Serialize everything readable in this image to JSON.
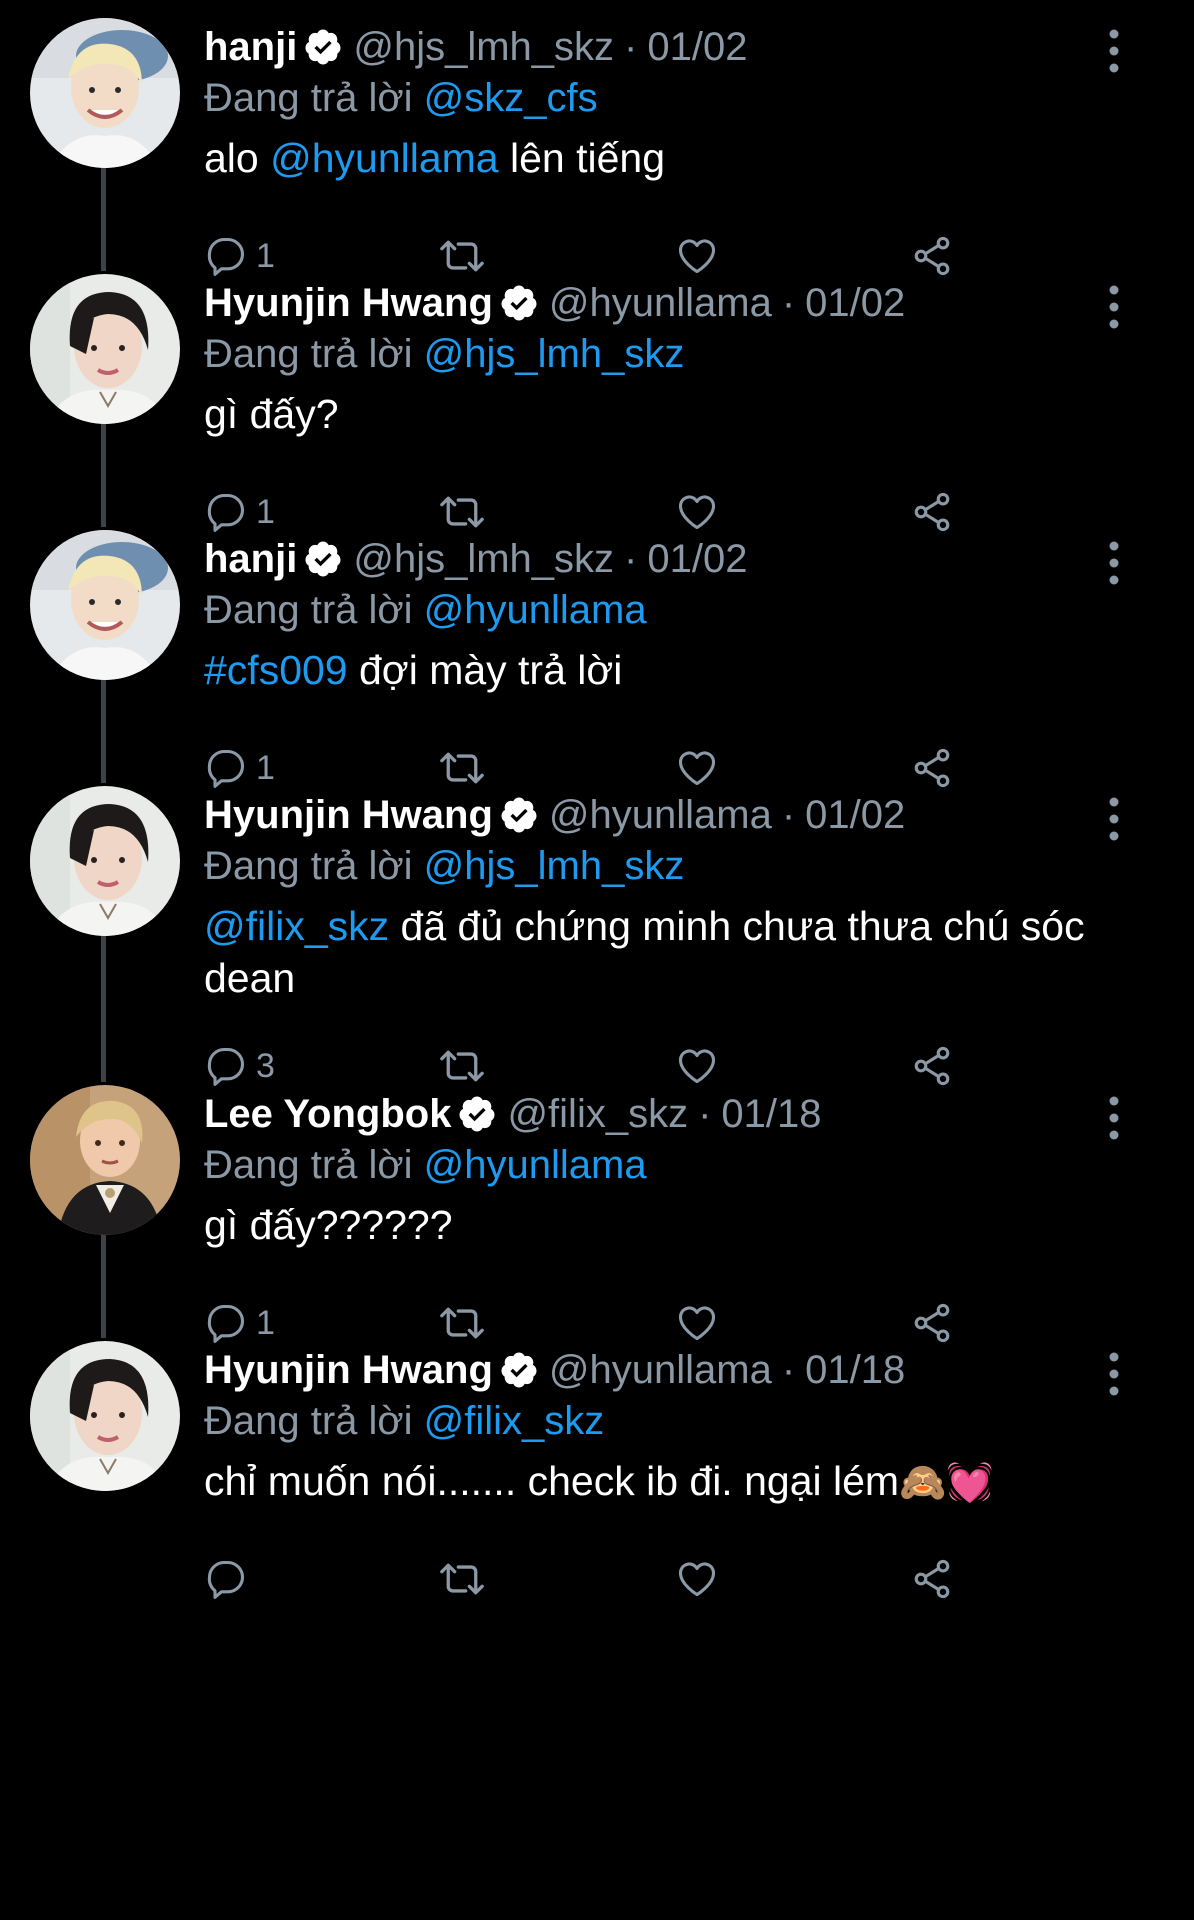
{
  "colors": {
    "background": "#000000",
    "text": "#ffffff",
    "secondary": "#8b98a5",
    "link": "#1d9bf0",
    "thread_line": "#3d4247"
  },
  "icons": {
    "verified": "verified-badge-icon",
    "more": "more-vertical-icon",
    "reply": "reply-bubble-icon",
    "retweet": "retweet-icon",
    "like": "heart-icon",
    "share": "share-icon"
  },
  "tweets": [
    {
      "name": "hanji",
      "handle": "@hjs_lmh_skz",
      "sep": "·",
      "date": "01/02",
      "replying_prefix": "Đang trả lời",
      "replying_to": "@skz_cfs",
      "text_parts": [
        {
          "text": "alo ",
          "link": false
        },
        {
          "text": "@hyunllama",
          "link": true
        },
        {
          "text": " lên tiếng",
          "link": false
        }
      ],
      "reply_count": "1",
      "avatar": "hanji"
    },
    {
      "name": "Hyunjin Hwang",
      "handle": "@hyunllama",
      "sep": "·",
      "date": "01/02",
      "replying_prefix": "Đang trả lời",
      "replying_to": "@hjs_lmh_skz",
      "text_parts": [
        {
          "text": "gì đấy?",
          "link": false
        }
      ],
      "reply_count": "1",
      "avatar": "hyunjin"
    },
    {
      "name": "hanji",
      "handle": "@hjs_lmh_skz",
      "sep": "·",
      "date": "01/02",
      "replying_prefix": "Đang trả lời",
      "replying_to": "@hyunllama",
      "text_parts": [
        {
          "text": "#cfs009",
          "link": true
        },
        {
          "text": " đợi mày trả lời",
          "link": false
        }
      ],
      "reply_count": "1",
      "avatar": "hanji"
    },
    {
      "name": "Hyunjin Hwang",
      "handle": "@hyunllama",
      "sep": "·",
      "date": "01/02",
      "replying_prefix": "Đang trả lời",
      "replying_to": "@hjs_lmh_skz",
      "text_parts": [
        {
          "text": "@filix_skz",
          "link": true
        },
        {
          "text": " đã đủ chứng minh chưa thưa chú sóc dean",
          "link": false
        }
      ],
      "reply_count": "3",
      "avatar": "hyunjin"
    },
    {
      "name": "Lee Yongbok",
      "handle": "@filix_skz",
      "sep": "·",
      "date": "01/18",
      "replying_prefix": "Đang trả lời",
      "replying_to": "@hyunllama",
      "text_parts": [
        {
          "text": "gì đấy??????",
          "link": false
        }
      ],
      "reply_count": "1",
      "avatar": "yongbok"
    },
    {
      "name": "Hyunjin Hwang",
      "handle": "@hyunllama",
      "sep": "·",
      "date": "01/18",
      "replying_prefix": "Đang trả lời",
      "replying_to": "@filix_skz",
      "text_parts": [
        {
          "text": "chỉ muốn nói....... check ib đi. ngại lém",
          "link": false
        },
        {
          "text": "🙈💓",
          "link": false,
          "emoji": true
        }
      ],
      "reply_count": "",
      "avatar": "hyunjin"
    }
  ]
}
